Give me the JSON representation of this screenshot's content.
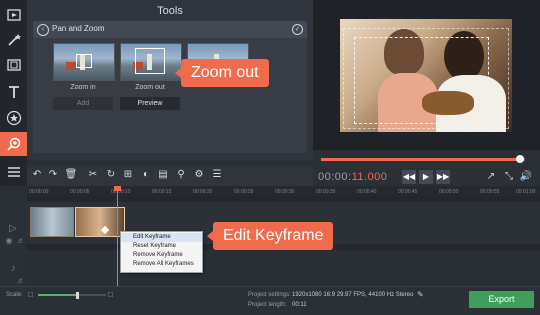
{
  "colors": {
    "accent": "#f06a4c",
    "export": "#3e9e5a",
    "background": "#2b2f36"
  },
  "toolstrip": {
    "items": [
      {
        "icon": "import-media-icon"
      },
      {
        "icon": "magic-wand-icon"
      },
      {
        "icon": "filmstrip-icon"
      },
      {
        "icon": "titles-icon"
      },
      {
        "icon": "star-icon"
      },
      {
        "icon": "zoom-icon",
        "active": true
      },
      {
        "icon": "more-menu-icon"
      }
    ]
  },
  "tools": {
    "title": "Tools",
    "panel_title": "Pan and Zoom",
    "thumbs": [
      {
        "label": "Zoom in",
        "button": "Add"
      },
      {
        "label": "Zoom out",
        "button": "Preview"
      },
      {
        "label": "",
        "button": ""
      }
    ]
  },
  "callouts": {
    "zoom_out": "Zoom out",
    "edit_keyframe": "Edit Keyframe"
  },
  "player": {
    "timecode_main": "00:00:",
    "timecode_ms": "11.000",
    "seek_progress": 0.97
  },
  "ruler": {
    "ticks": [
      "00:00:00",
      "00:00:05",
      "00:00:10",
      "00:00:15",
      "00:00:20",
      "00:00:25",
      "00:00:30",
      "00:00:35",
      "00:00:40",
      "00:00:45",
      "00:00:50",
      "00:00:55",
      "00:01:00"
    ]
  },
  "context_menu": {
    "items": [
      "Edit Keyframe",
      "Reset Keyframe",
      "Remove Keyframe",
      "Remove All Keyframes"
    ]
  },
  "bottom": {
    "scale_label": "Scale:",
    "project_settings_label": "Project settings:",
    "project_settings_value": "1920x1080 16:9 29.97 FPS, 44100 Hz Stereo",
    "project_length_label": "Project length:",
    "project_length_value": "00:11",
    "export_label": "Export"
  }
}
